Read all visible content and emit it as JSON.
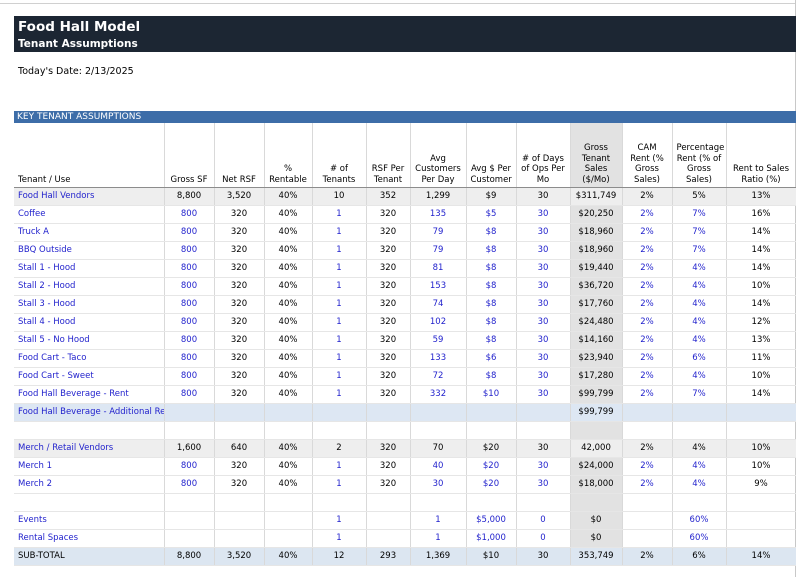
{
  "title": "Food Hall Model",
  "subtitle": "Tenant Assumptions",
  "date_label": "Today's Date: 2/13/2025",
  "section_title": "KEY TENANT ASSUMPTIONS",
  "columns": [
    "Tenant / Use",
    "Gross SF",
    "Net RSF",
    "% Rentable",
    "# of Tenants",
    "RSF Per Tenant",
    "Avg Customers Per Day",
    "Avg $ Per Customer",
    "# of Days of Ops Per Mo",
    "Gross Tenant Sales ($/Mo)",
    "CAM Rent (% Gross Sales)",
    "Percentage Rent (% of Gross Sales)",
    "Rent to Sales Ratio (%)"
  ],
  "rows": [
    {
      "kind": "sum",
      "cells": [
        "Food Hall Vendors",
        "8,800",
        "3,520",
        "40%",
        "10",
        "352",
        "1,299",
        "$9",
        "30",
        "$311,749",
        "2%",
        "5%",
        "13%"
      ]
    },
    {
      "kind": "item",
      "cells": [
        "Coffee",
        "800",
        "320",
        "40%",
        "1",
        "320",
        "135",
        "$5",
        "30",
        "$20,250",
        "2%",
        "7%",
        "16%"
      ]
    },
    {
      "kind": "item",
      "cells": [
        "Truck A",
        "800",
        "320",
        "40%",
        "1",
        "320",
        "79",
        "$8",
        "30",
        "$18,960",
        "2%",
        "7%",
        "14%"
      ]
    },
    {
      "kind": "item",
      "cells": [
        "BBQ Outside",
        "800",
        "320",
        "40%",
        "1",
        "320",
        "79",
        "$8",
        "30",
        "$18,960",
        "2%",
        "7%",
        "14%"
      ]
    },
    {
      "kind": "item",
      "cells": [
        "Stall 1 - Hood",
        "800",
        "320",
        "40%",
        "1",
        "320",
        "81",
        "$8",
        "30",
        "$19,440",
        "2%",
        "4%",
        "14%"
      ]
    },
    {
      "kind": "item",
      "cells": [
        "Stall 2 - Hood",
        "800",
        "320",
        "40%",
        "1",
        "320",
        "153",
        "$8",
        "30",
        "$36,720",
        "2%",
        "4%",
        "10%"
      ]
    },
    {
      "kind": "item",
      "cells": [
        "Stall 3 - Hood",
        "800",
        "320",
        "40%",
        "1",
        "320",
        "74",
        "$8",
        "30",
        "$17,760",
        "2%",
        "4%",
        "14%"
      ]
    },
    {
      "kind": "item",
      "cells": [
        "Stall 4 - Hood",
        "800",
        "320",
        "40%",
        "1",
        "320",
        "102",
        "$8",
        "30",
        "$24,480",
        "2%",
        "4%",
        "12%"
      ]
    },
    {
      "kind": "item",
      "cells": [
        "Stall 5 - No Hood",
        "800",
        "320",
        "40%",
        "1",
        "320",
        "59",
        "$8",
        "30",
        "$14,160",
        "2%",
        "4%",
        "13%"
      ]
    },
    {
      "kind": "item",
      "cells": [
        "Food Cart - Taco",
        "800",
        "320",
        "40%",
        "1",
        "320",
        "133",
        "$6",
        "30",
        "$23,940",
        "2%",
        "6%",
        "11%"
      ]
    },
    {
      "kind": "item",
      "cells": [
        "Food Cart - Sweet",
        "800",
        "320",
        "40%",
        "1",
        "320",
        "72",
        "$8",
        "30",
        "$17,280",
        "2%",
        "4%",
        "10%"
      ]
    },
    {
      "kind": "item",
      "cells": [
        "Food Hall Beverage - Rent",
        "800",
        "320",
        "40%",
        "1",
        "320",
        "332",
        "$10",
        "30",
        "$99,799",
        "2%",
        "7%",
        "14%"
      ]
    },
    {
      "kind": "hilite",
      "cells": [
        "Food Hall Beverage - Additional Revenue",
        "",
        "",
        "",
        "",
        "",
        "",
        "",
        "",
        "$99,799",
        "",
        "",
        ""
      ]
    },
    {
      "kind": "blank",
      "cells": [
        "",
        "",
        "",
        "",
        "",
        "",
        "",
        "",
        "",
        "",
        "",
        "",
        ""
      ]
    },
    {
      "kind": "sum",
      "cells": [
        "Merch / Retail Vendors",
        "1,600",
        "640",
        "40%",
        "2",
        "320",
        "70",
        "$20",
        "30",
        "42,000",
        "2%",
        "4%",
        "10%"
      ]
    },
    {
      "kind": "item",
      "cells": [
        "Merch 1",
        "800",
        "320",
        "40%",
        "1",
        "320",
        "40",
        "$20",
        "30",
        "$24,000",
        "2%",
        "4%",
        "10%"
      ]
    },
    {
      "kind": "item",
      "cells": [
        "Merch 2",
        "800",
        "320",
        "40%",
        "1",
        "320",
        "30",
        "$20",
        "30",
        "$18,000",
        "2%",
        "4%",
        "9%"
      ]
    },
    {
      "kind": "blank",
      "cells": [
        "",
        "",
        "",
        "",
        "",
        "",
        "",
        "",
        "",
        "",
        "",
        "",
        ""
      ]
    },
    {
      "kind": "item",
      "cells": [
        "Events",
        "",
        "",
        "",
        "1",
        "",
        "1",
        "$5,000",
        "0",
        "$0",
        "",
        "60%",
        ""
      ]
    },
    {
      "kind": "item",
      "cells": [
        "Rental Spaces",
        "",
        "",
        "",
        "1",
        "",
        "1",
        "$1,000",
        "0",
        "$0",
        "",
        "60%",
        ""
      ]
    },
    {
      "kind": "subtotal",
      "cells": [
        "SUB-TOTAL",
        "8,800",
        "3,520",
        "40%",
        "12",
        "293",
        "1,369",
        "$10",
        "30",
        "353,749",
        "2%",
        "6%",
        "14%"
      ]
    }
  ],
  "colors": {
    "banner": "#1c2633",
    "section_header": "#3d6da8",
    "input_text": "#1f1fcc",
    "subtotal_fill": "#dce6f1"
  }
}
